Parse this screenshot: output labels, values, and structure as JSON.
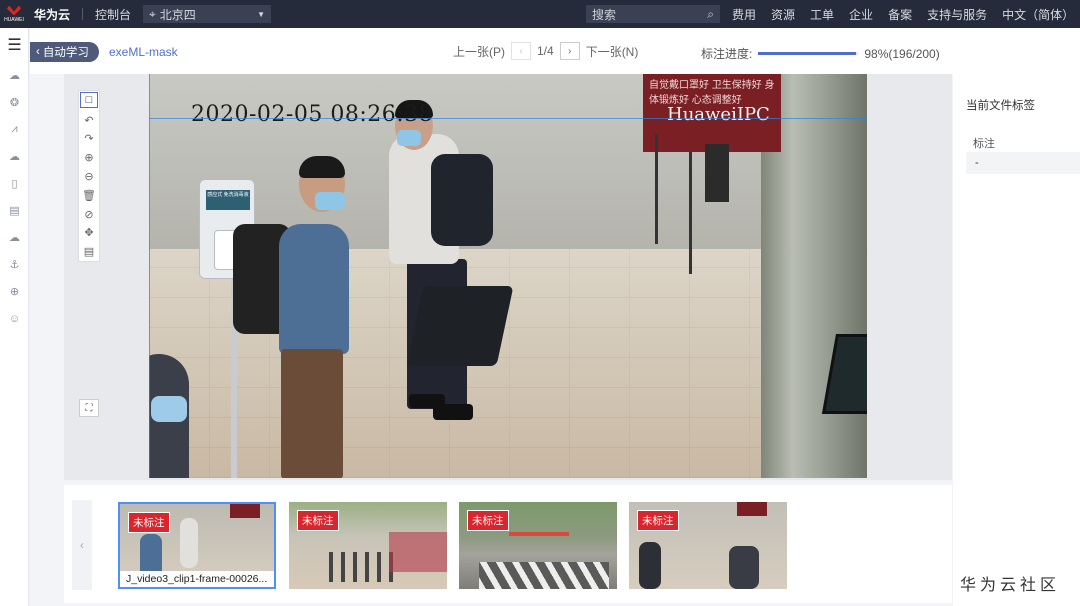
{
  "topbar": {
    "brand": "华为云",
    "console": "控制台",
    "region": "北京四",
    "search_placeholder": "搜索",
    "nav": [
      "费用",
      "资源",
      "工单",
      "企业",
      "备案",
      "支持与服务",
      "中文（简体）"
    ]
  },
  "header": {
    "back_label": "自动学习",
    "dataset_name": "exeML-mask",
    "prev_label": "上一张(P)",
    "page_indicator": "1/4",
    "next_label": "下一张(N)",
    "progress_label": "标注进度:",
    "progress_text": "98%(196/200)",
    "progress_fraction": 0.98
  },
  "image": {
    "timestamp": "2020-02-05 08:26:38",
    "camera_label": "HuaweiIPC",
    "banner_text": "自觉戴口罩好 卫生保持好 身体锻炼好 心态调整好",
    "dispenser_label": "感应式 免洗消毒液"
  },
  "tools": [
    "rectangle-icon",
    "undo-icon",
    "redo-icon",
    "zoom-in-icon",
    "zoom-out-icon",
    "delete-icon",
    "clear-icon",
    "move-icon",
    "list-icon"
  ],
  "right_panel": {
    "title": "当前文件标签",
    "label_header": "标注",
    "label_value": "-"
  },
  "thumbnails": [
    {
      "badge": "未标注",
      "caption": "J_video3_clip1-frame-00026...",
      "selected": true
    },
    {
      "badge": "未标注",
      "caption": "",
      "selected": false
    },
    {
      "badge": "未标注",
      "caption": "",
      "selected": false
    },
    {
      "badge": "未标注",
      "caption": "",
      "selected": false
    }
  ],
  "watermark": "华为云社区",
  "colors": {
    "topbar": "#252b3a",
    "accent": "#526ecc",
    "badge": "#d9262e",
    "selected_border": "#4f8ff7"
  }
}
